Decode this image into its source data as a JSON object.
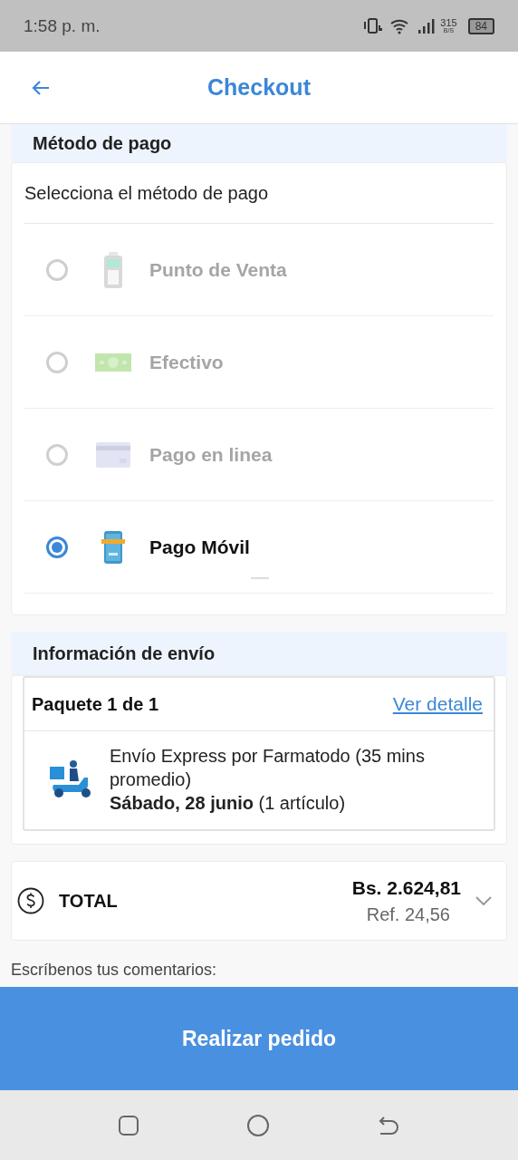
{
  "status_bar": {
    "time": "1:58 p. m.",
    "speed_value": "315",
    "speed_unit": "B/S",
    "battery": "84"
  },
  "header": {
    "title": "Checkout"
  },
  "payment": {
    "heading": "Método de pago",
    "prompt": "Selecciona el método de pago",
    "methods": [
      {
        "kind": "pos",
        "label": "Punto de Venta",
        "selected": false,
        "disabled": true
      },
      {
        "kind": "cash",
        "label": "Efectivo",
        "selected": false,
        "disabled": true
      },
      {
        "kind": "card",
        "label": "Pago en linea",
        "selected": false,
        "disabled": true
      },
      {
        "kind": "phone",
        "label": "Pago Móvil",
        "selected": true,
        "disabled": false
      }
    ]
  },
  "shipping": {
    "heading": "Información de envío",
    "package": "Paquete 1 de 1",
    "detail_link": "Ver detalle",
    "description": "Envío Express por Farmatodo (35 mins promedio)",
    "date": "**Sábado, 28 junio** (1 artículo)"
  },
  "total": {
    "label": "TOTAL",
    "amount": "Bs. 2.624,81",
    "reference": "Ref. 24,56"
  },
  "comments_label": "Escríbenos tus comentarios:",
  "submit": "Realizar pedido"
}
